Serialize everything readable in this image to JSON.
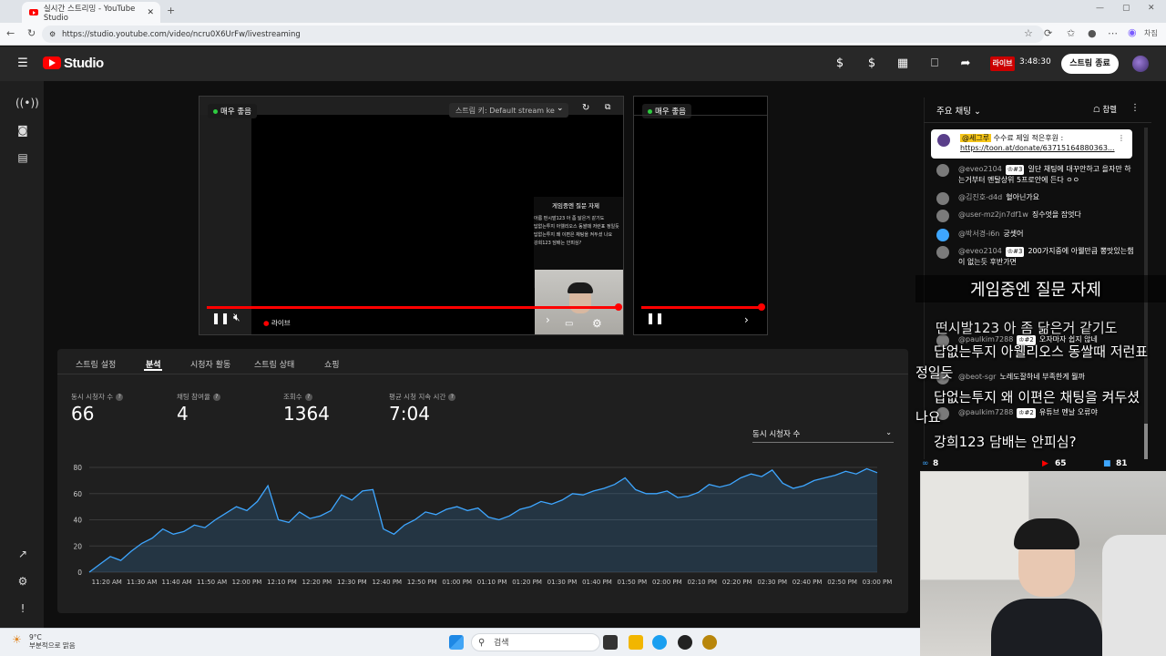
{
  "browser": {
    "tab_title": "실시간 스트리밍 - YouTube Studio",
    "url": "https://studio.youtube.com/video/ncru0X6UrFw/livestreaming",
    "profile_label": "차짐"
  },
  "header": {
    "logo": "Studio",
    "live_badge": "라이브",
    "live_time": "3:48:30",
    "end_stream_button": "스트림 종료"
  },
  "preview": {
    "quality_label": "매우 좋음",
    "stream_key_label": "스트림 키: Default stream ke",
    "live_indicator": "라이브",
    "mini_caption_title": "게임중엔 질문 자제",
    "mini_captions": [
      "아름 떤시발123 아 좀 닮은거 같기도",
      "답없는투지 아웰리오스 동쌀때 저런표 정일듯",
      "답없는투지 왜 이편은 채팅을 켜두셨 나요",
      "강희123 담배는 안피심?"
    ]
  },
  "analytics": {
    "tabs": [
      "스트림 설정",
      "분석",
      "시청자 활동",
      "스트림 상태",
      "쇼핑"
    ],
    "active_tab": "분석",
    "metrics": [
      {
        "label": "동시 시청자 수",
        "value": "66"
      },
      {
        "label": "채팅 참여율",
        "value": "4"
      },
      {
        "label": "조회수",
        "value": "1364"
      },
      {
        "label": "평균 시청 지속 시간",
        "value": "7:04"
      }
    ],
    "metric_select": "동시 시청자 수"
  },
  "chart_data": {
    "type": "area",
    "title": "",
    "xlabel": "",
    "ylabel": "",
    "ylim": [
      0,
      80
    ],
    "yticks": [
      0,
      20,
      40,
      60,
      80
    ],
    "xticks": [
      "11:20 AM",
      "11:30 AM",
      "11:40 AM",
      "11:50 AM",
      "12:00 PM",
      "12:10 PM",
      "12:20 PM",
      "12:30 PM",
      "12:40 PM",
      "12:50 PM",
      "01:00 PM",
      "01:10 PM",
      "01:20 PM",
      "01:30 PM",
      "01:40 PM",
      "01:50 PM",
      "02:00 PM",
      "02:10 PM",
      "02:20 PM",
      "02:30 PM",
      "02:40 PM",
      "02:50 PM",
      "03:00 PM"
    ],
    "x_minutes_from_1115": [
      0,
      3,
      6,
      9,
      12,
      15,
      18,
      21,
      24,
      27,
      30,
      33,
      36,
      39,
      42,
      45,
      48,
      51,
      54,
      57,
      60,
      63,
      66,
      69,
      72,
      75,
      78,
      81,
      84,
      87,
      90,
      93,
      96,
      99,
      102,
      105,
      108,
      111,
      114,
      117,
      120,
      123,
      126,
      129,
      132,
      135,
      138,
      141,
      144,
      147,
      150,
      153,
      156,
      159,
      162,
      165,
      168,
      171,
      174,
      177,
      180,
      183,
      186,
      189,
      192,
      195,
      198,
      201,
      204,
      207,
      210,
      213,
      216,
      219,
      222,
      225
    ],
    "values": [
      0,
      6,
      12,
      9,
      16,
      22,
      26,
      33,
      29,
      31,
      36,
      34,
      40,
      45,
      50,
      47,
      54,
      66,
      40,
      38,
      46,
      41,
      43,
      47,
      59,
      55,
      62,
      63,
      33,
      29,
      36,
      40,
      46,
      44,
      48,
      50,
      47,
      49,
      42,
      40,
      43,
      48,
      50,
      54,
      52,
      55,
      60,
      59,
      62,
      64,
      67,
      72,
      63,
      60,
      60,
      62,
      57,
      58,
      61,
      67,
      65,
      67,
      72,
      75,
      73,
      78,
      68,
      64,
      66,
      70,
      72,
      74,
      77,
      75,
      79,
      76
    ],
    "series_color": "#3ea6ff",
    "grid": true
  },
  "chat": {
    "title": "주요 채팅",
    "members_label": "참렐",
    "pinned": {
      "author": "@세그루",
      "text": "수수료 제일 적은후원 : ",
      "link": "https://toon.at/donate/63715164880363..."
    },
    "messages": [
      {
        "name": "@eveo2104",
        "badge": "#3",
        "text": "일단 채팅에 대꾸안하고 을자만 하는거부터 멘탈상위 5프로안에 든다 ㅇㅇ"
      },
      {
        "name": "@김진호-d4d",
        "badge": "",
        "text": "혈아닌가요"
      },
      {
        "name": "@user-mz2jn7df1w",
        "badge": "",
        "text": "징수엇을 잡엇다"
      },
      {
        "name": "@박서경-i6n",
        "badge": "",
        "text": "궁셋어"
      },
      {
        "name": "@eveo2104",
        "badge": "#3",
        "text": "200가지중에 아웰만큼 뽕맛있는챔이 없는듯 후반가면"
      },
      {
        "name": "@paulkim7288",
        "badge": "#2",
        "text": "오자마자 쉽지 않네"
      },
      {
        "name": "@beot-sgr",
        "badge": "",
        "text": "노레도잘하네 부족한게 뭘까"
      },
      {
        "name": "@paulkim7288",
        "badge": "#2",
        "text": "유튜브 멘날 오류야"
      }
    ],
    "stats": [
      {
        "label": "8"
      },
      {
        "label": "65"
      },
      {
        "label": "81"
      }
    ]
  },
  "overlay": {
    "title": "게임중엔 질문 자제",
    "lines": [
      "떤시발123 아 좀 닮은거 같기도",
      "답없는투지 아웰리오스 동쌀때 저런표",
      "정일듯",
      "답없는투지 왜 이편은 채팅을 켜두셨",
      "나요",
      "강희123 담배는 안피심?"
    ]
  },
  "taskbar": {
    "weather_temp": "9°C",
    "weather_text": "부분적으로 맑음",
    "search_placeholder": "검색"
  }
}
